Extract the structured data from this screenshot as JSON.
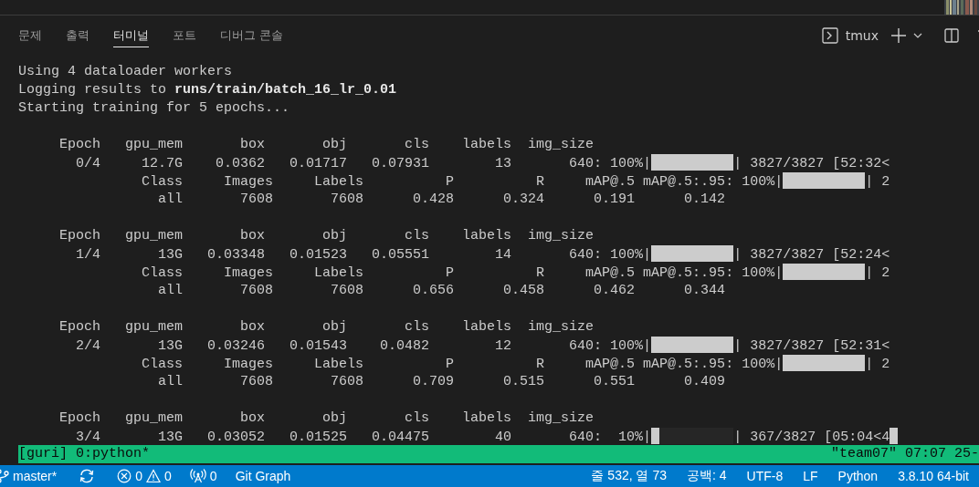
{
  "panel": {
    "tabs": [
      {
        "label": "문제",
        "selected": false
      },
      {
        "label": "출력",
        "selected": false
      },
      {
        "label": "터미널",
        "selected": true
      },
      {
        "label": "포트",
        "selected": false
      },
      {
        "label": "디버그 콘솔",
        "selected": false
      }
    ],
    "terminal_name": "tmux"
  },
  "terminal": {
    "lines": [
      {
        "kind": "text",
        "segments": [
          {
            "kind": "text",
            "text": "Using 4 dataloader workers"
          }
        ]
      },
      {
        "kind": "text",
        "segments": [
          {
            "kind": "text",
            "text": "Logging results to **runs/train/batch_16_lr_0.01**"
          }
        ]
      },
      {
        "kind": "text",
        "segments": [
          {
            "kind": "text",
            "text": "Starting training for 5 epochs..."
          }
        ]
      },
      {
        "kind": "blank"
      },
      {
        "kind": "text",
        "segments": [
          {
            "kind": "text",
            "text": "     Epoch   gpu_mem       box       obj       cls    labels  img_size"
          }
        ]
      },
      {
        "kind": "text",
        "segments": [
          {
            "kind": "text",
            "text": "       0/4     12.7G    0.0362   0.01717   0.07931        13       640: 100%|"
          },
          {
            "kind": "bar",
            "level": 1
          },
          {
            "kind": "text",
            "text": "| 3827/3827 [52:32<"
          }
        ]
      },
      {
        "kind": "text",
        "segments": [
          {
            "kind": "text",
            "text": "               Class     Images     Labels          P          R     mAP@.5 mAP@.5:.95: 100%|"
          },
          {
            "kind": "bar",
            "level": 1
          },
          {
            "kind": "text",
            "text": "| 2"
          }
        ]
      },
      {
        "kind": "text",
        "segments": [
          {
            "kind": "text",
            "text": "                 all       7608       7608      0.428      0.324      0.191      0.142"
          }
        ]
      },
      {
        "kind": "blank"
      },
      {
        "kind": "text",
        "segments": [
          {
            "kind": "text",
            "text": "     Epoch   gpu_mem       box       obj       cls    labels  img_size"
          }
        ]
      },
      {
        "kind": "text",
        "segments": [
          {
            "kind": "text",
            "text": "       1/4       13G   0.03348   0.01523   0.05551        14       640: 100%|"
          },
          {
            "kind": "bar",
            "level": 1
          },
          {
            "kind": "text",
            "text": "| 3827/3827 [52:24<"
          }
        ]
      },
      {
        "kind": "text",
        "segments": [
          {
            "kind": "text",
            "text": "               Class     Images     Labels          P          R     mAP@.5 mAP@.5:.95: 100%|"
          },
          {
            "kind": "bar",
            "level": 1
          },
          {
            "kind": "text",
            "text": "| 2"
          }
        ]
      },
      {
        "kind": "text",
        "segments": [
          {
            "kind": "text",
            "text": "                 all       7608       7608      0.656      0.458      0.462      0.344"
          }
        ]
      },
      {
        "kind": "blank"
      },
      {
        "kind": "text",
        "segments": [
          {
            "kind": "text",
            "text": "     Epoch   gpu_mem       box       obj       cls    labels  img_size"
          }
        ]
      },
      {
        "kind": "text",
        "segments": [
          {
            "kind": "text",
            "text": "       2/4       13G   0.03246   0.01543    0.0482        12       640: 100%|"
          },
          {
            "kind": "bar",
            "level": 1
          },
          {
            "kind": "text",
            "text": "| 3827/3827 [52:31<"
          }
        ]
      },
      {
        "kind": "text",
        "segments": [
          {
            "kind": "text",
            "text": "               Class     Images     Labels          P          R     mAP@.5 mAP@.5:.95: 100%|"
          },
          {
            "kind": "bar",
            "level": 1
          },
          {
            "kind": "text",
            "text": "| 2"
          }
        ]
      },
      {
        "kind": "text",
        "segments": [
          {
            "kind": "text",
            "text": "                 all       7608       7608      0.709      0.515      0.551      0.409"
          }
        ]
      },
      {
        "kind": "blank"
      },
      {
        "kind": "text",
        "segments": [
          {
            "kind": "text",
            "text": "     Epoch   gpu_mem       box       obj       cls    labels  img_size"
          }
        ]
      },
      {
        "kind": "text",
        "segments": [
          {
            "kind": "text",
            "text": "       3/4       13G   0.03052   0.01525   0.04475        40       640:  10%|"
          },
          {
            "kind": "bar",
            "level": 0.1
          },
          {
            "kind": "text",
            "text": "| 367/3827 [05:04<4"
          },
          {
            "kind": "cursor"
          }
        ]
      }
    ]
  },
  "tmux_status": {
    "left": "[guri] 0:python*",
    "right": "\"team07\" 07:07 25-"
  },
  "status_bar": {
    "branch": "master*",
    "errors": "0",
    "warnings": "0",
    "ports": "0",
    "items_left": [
      "Git Graph"
    ],
    "items_right": [
      "줄 532, 열 73",
      "공백: 4",
      "UTF-8",
      "LF",
      "Python",
      "3.8.10 64-bit"
    ]
  }
}
